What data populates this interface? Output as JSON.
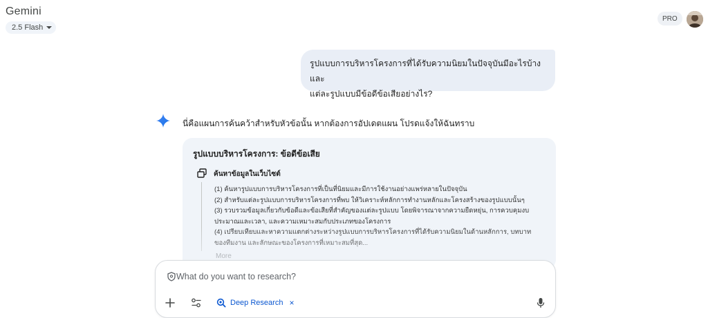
{
  "header": {
    "app_title": "Gemini",
    "model": "2.5 Flash",
    "plan_badge": "PRO"
  },
  "conversation": {
    "user_message": {
      "line1": "รูปแบบการบริหารโครงการที่ได้รับความนิยมในปัจจุบันมีอะไรบ้าง และ",
      "line2": "แต่ละรูปแบบมีข้อดีข้อเสียอย่างไร?"
    },
    "response": {
      "intro": "นี่คือแผนการค้นคว้าสำหรับหัวข้อนั้น หากต้องการอัปเดตแผน โปรดแจ้งให้ฉันทราบ",
      "plan": {
        "title": "รูปแบบบริหารโครงการ: ข้อดีข้อเสีย",
        "section_label": "ค้นหาข้อมูลในเว็บไซต์",
        "steps": [
          "(1) ค้นหารูปแบบการบริหารโครงการที่เป็นที่นิยมและมีการใช้งานอย่างแพร่หลายในปัจจุบัน",
          "(2) สำหรับแต่ละรูปแบบการบริหารโครงการที่พบ ให้วิเคราะห์หลักการทำงานหลักและโครงสร้างของรูปแบบนั้นๆ",
          "(3) รวบรวมข้อมูลเกี่ยวกับข้อดีและข้อเสียที่สำคัญของแต่ละรูปแบบ โดยพิจารณาจากความยืดหยุ่น, การควบคุมงบ",
          "ประมาณและเวลา, และความเหมาะสมกับประเภทของโครงการ",
          "(4) เปรียบเทียบและหาความแตกต่างระหว่างรูปแบบการบริหารโครงการที่ได้รับความนิยมในด้านหลักการ, บทบาท",
          "ของทีมงาน และลักษณะของโครงการที่เหมาะสมที่สุด..."
        ],
        "more_label": "More"
      }
    }
  },
  "composer": {
    "placeholder": "What do you want to research?",
    "value": "",
    "chip_label": "Deep Research",
    "chip_close": "×"
  },
  "colors": {
    "accent": "#0b57d0",
    "user_bubble": "#e9eef6",
    "plan_card": "#f0f4f9"
  },
  "icons": {
    "model_caret": "chevron-down-icon",
    "response": "gemini-sparkle-icon",
    "plan_section": "web-search-icon",
    "composer_lead": "shield-icon",
    "add": "plus-icon",
    "tools": "tools-sliders-icon",
    "chip": "deep-research-icon",
    "mic": "microphone-icon"
  }
}
